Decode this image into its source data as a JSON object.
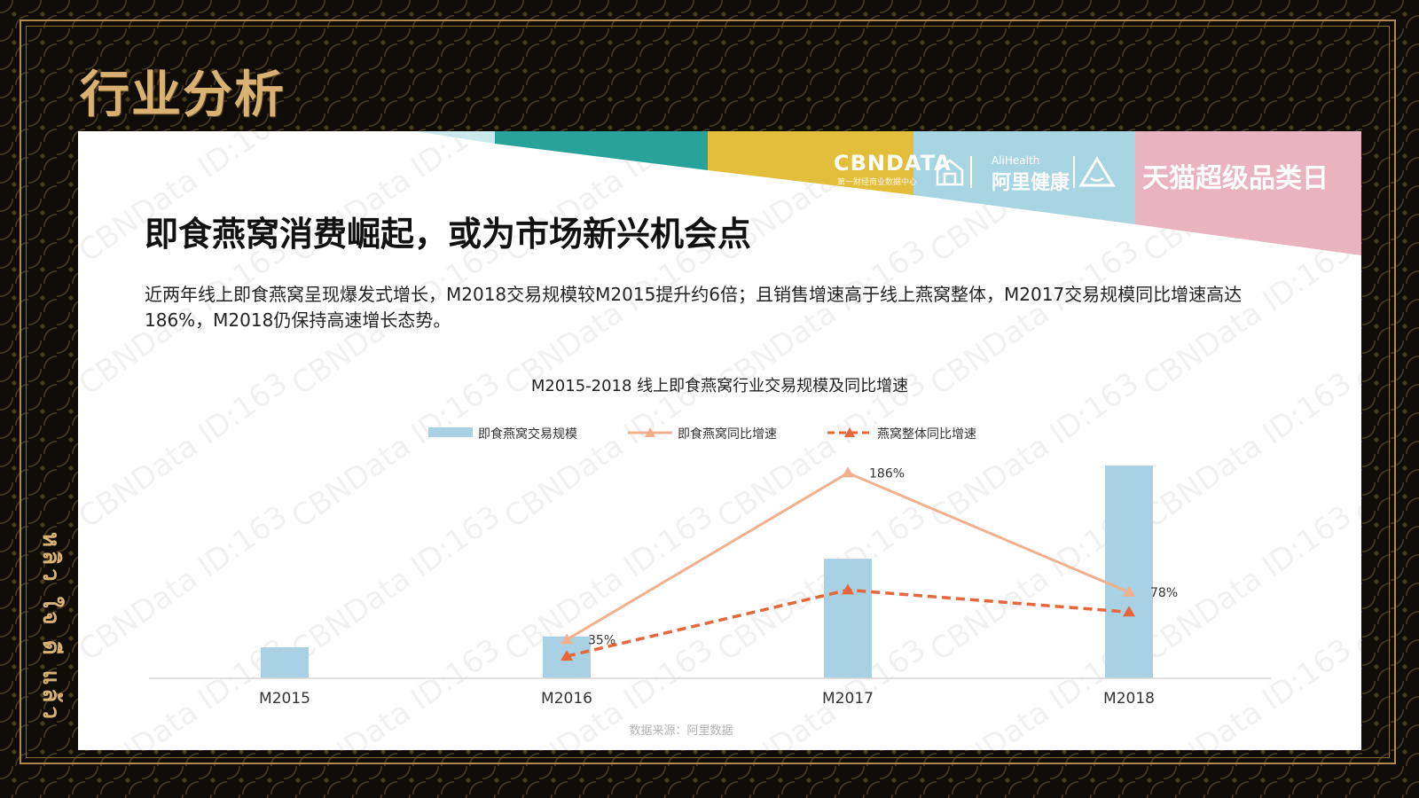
{
  "header": {
    "title": "行业分析"
  },
  "side_text": "หลิว ใจ ดี แล้ว",
  "brands": {
    "cbndata": "CBNDATA",
    "cbndata_sub": "第一财经商业数据中心",
    "allhealth_en": "AliHealth",
    "allhealth": "阿里健康",
    "tmall": "天猫超级品类日"
  },
  "slide": {
    "headline": "即食燕窝消费崛起，或为市场新兴机会点",
    "description": "近两年线上即食燕窝呈现爆发式增长，M2018交易规模较M2015提升约6倍；且销售增速高于线上燕窝整体，M2017交易规模同比增速高达186%，M2018仍保持高速增长态势。",
    "source": "数据来源：阿里数据",
    "watermark": "CBNData ID:163"
  },
  "chart_data": {
    "type": "bar",
    "title": "M2015-2018 线上即食燕窝行业交易规模及同比增速",
    "categories": [
      "M2015",
      "M2016",
      "M2017",
      "M2018"
    ],
    "series": [
      {
        "name": "即食燕窝交易规模",
        "kind": "bar",
        "values": [
          1.0,
          1.35,
          3.86,
          6.87
        ],
        "color": "#a8d1e3"
      },
      {
        "name": "即食燕窝同比增速",
        "kind": "line",
        "values": [
          null,
          35,
          186,
          78
        ],
        "labels": [
          "",
          "35%",
          "186%",
          "78%"
        ],
        "color": "#f2b08f"
      },
      {
        "name": "燕窝整体同比增速",
        "kind": "dashed-line",
        "values": [
          null,
          20,
          80,
          60
        ],
        "color": "#e8673a"
      }
    ],
    "legend": "top-center",
    "grid": false,
    "xlabel": "",
    "ylabel": ""
  },
  "colors": {
    "gold": "#d9b273",
    "teal": "#27a39b",
    "yellow": "#e2be3a",
    "lightblue": "#a8d5e2",
    "pink": "#eab3c0"
  }
}
